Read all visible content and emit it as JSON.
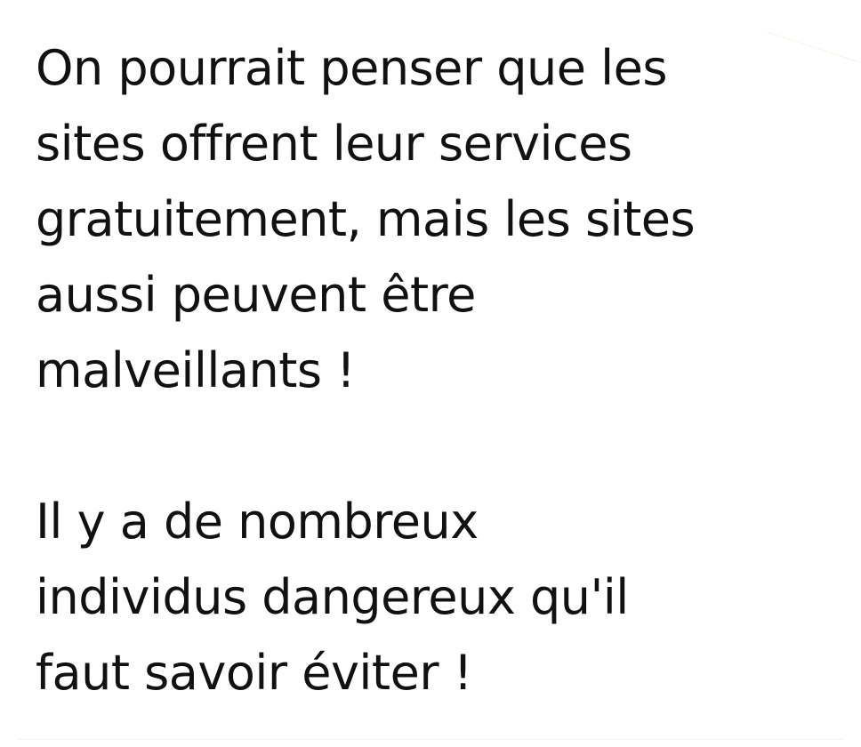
{
  "paragraphs": [
    {
      "lines": [
        "On pourrait penser que les",
        "sites offrent leur services",
        "gratuitement, mais les sites",
        "aussi peuvent être",
        "malveillants !"
      ]
    },
    {
      "lines": [
        "Il y a de nombreux",
        "individus dangereux qu'il",
        "faut savoir éviter !"
      ]
    }
  ]
}
